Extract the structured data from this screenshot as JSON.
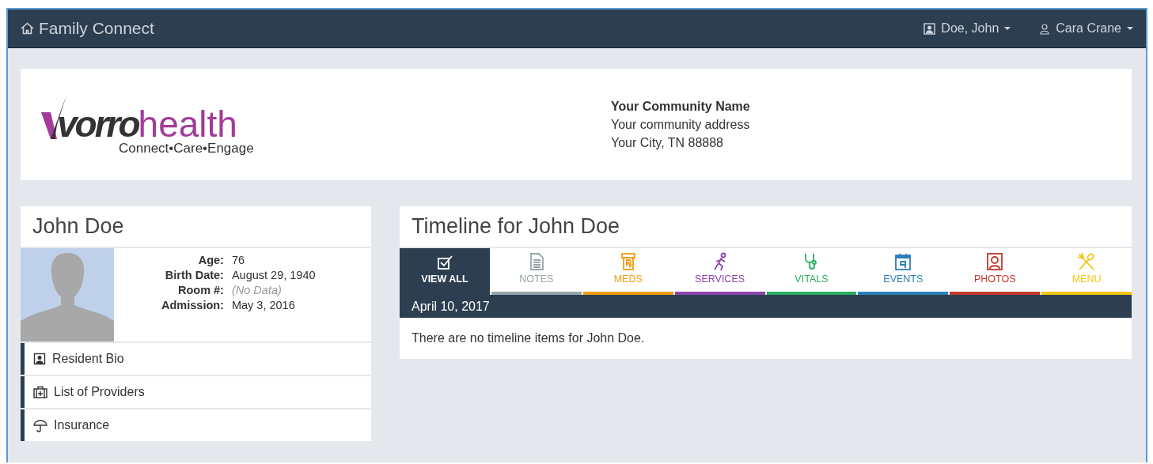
{
  "navbar": {
    "brand": "Family Connect",
    "menus": [
      {
        "kind": "resident",
        "label": "Doe, John"
      },
      {
        "kind": "user",
        "label": "Cara Crane"
      }
    ]
  },
  "header": {
    "logo": {
      "word1": "vorro",
      "word2": "health",
      "tagline": "Connect•Care•Engage"
    },
    "community": {
      "name": "Your Community Name",
      "address": "Your community address",
      "city": "Your City, TN 88888"
    }
  },
  "resident": {
    "name": "John Doe",
    "details": [
      {
        "label": "Age:",
        "value": "76",
        "missing": false
      },
      {
        "label": "Birth Date:",
        "value": "August 29, 1940",
        "missing": false
      },
      {
        "label": "Room #:",
        "value": "(No Data)",
        "missing": true
      },
      {
        "label": "Admission:",
        "value": "May 3, 2016",
        "missing": false
      }
    ],
    "links": [
      {
        "kind": "bio",
        "label": "Resident Bio"
      },
      {
        "kind": "providers",
        "label": "List of Providers"
      },
      {
        "kind": "insurance",
        "label": "Insurance"
      }
    ]
  },
  "timeline": {
    "title": "Timeline for John Doe",
    "tabs": [
      {
        "kind": "all",
        "label": "VIEW ALL",
        "color": "#2d3e50",
        "selected": true
      },
      {
        "kind": "notes",
        "label": "NOTES",
        "color": "#95a5a6",
        "selected": false
      },
      {
        "kind": "meds",
        "label": "MEDS",
        "color": "#f39c12",
        "selected": false
      },
      {
        "kind": "services",
        "label": "SERVICES",
        "color": "#8e44ad",
        "selected": false
      },
      {
        "kind": "vitals",
        "label": "VITALS",
        "color": "#27ae60",
        "selected": false
      },
      {
        "kind": "events",
        "label": "EVENTS",
        "color": "#2980b9",
        "selected": false
      },
      {
        "kind": "photos",
        "label": "PHOTOS",
        "color": "#c0392b",
        "selected": false
      },
      {
        "kind": "menu",
        "label": "MENU",
        "color": "#f1c40f",
        "selected": false
      }
    ],
    "date": "April 10, 2017",
    "empty_message": "There are no timeline items for John Doe."
  }
}
